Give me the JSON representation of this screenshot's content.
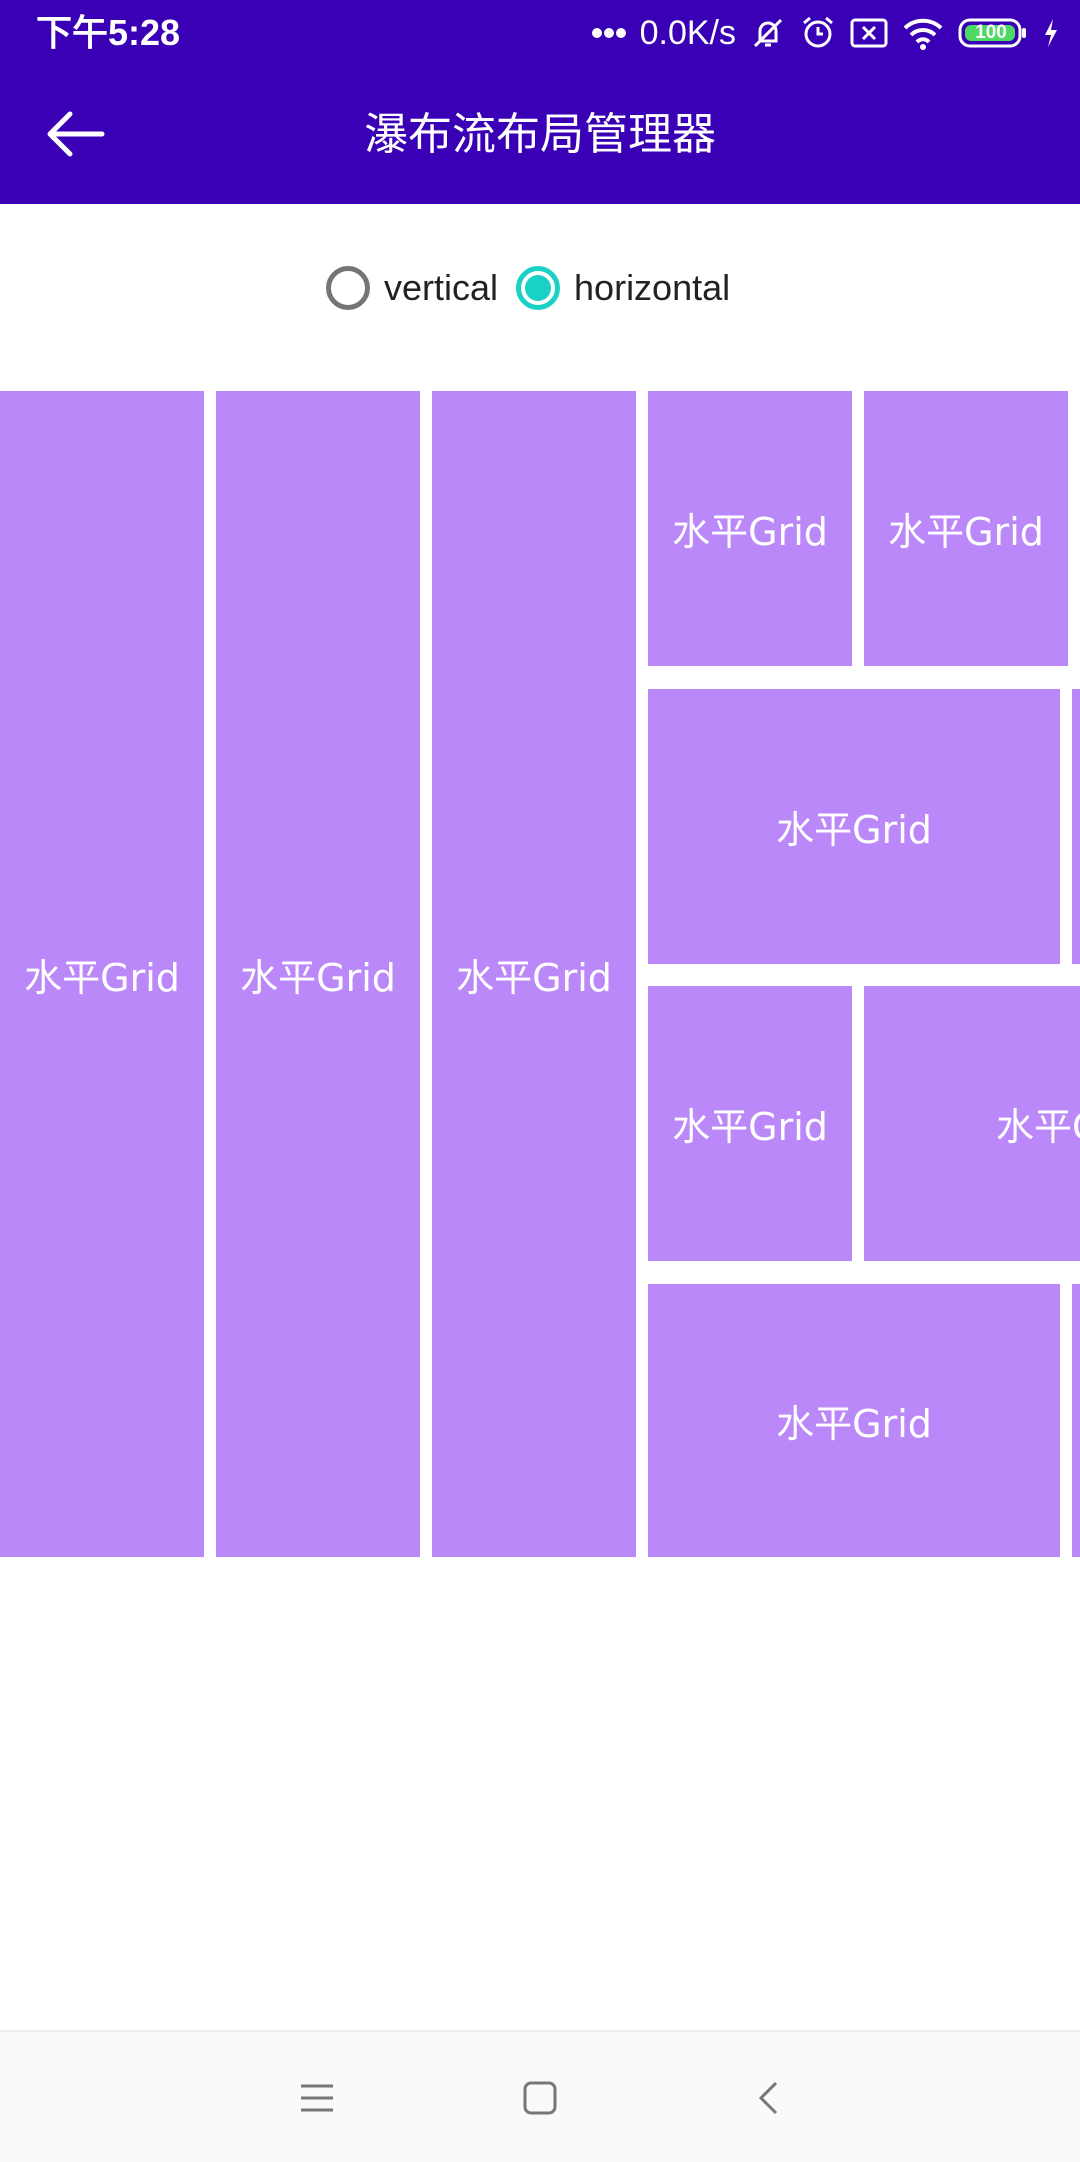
{
  "status_bar": {
    "time": "下午5:28",
    "network_speed": "0.0K/s",
    "battery": "100",
    "icons": [
      "dots-icon",
      "mute-icon",
      "alarm-icon",
      "sim-off-icon",
      "wifi-icon",
      "battery-icon",
      "charging-icon"
    ]
  },
  "app_bar": {
    "title": "瀑布流布局管理器",
    "back_icon": "arrow-back-icon"
  },
  "orientation": {
    "options": [
      "vertical",
      "horizontal"
    ],
    "selected": "horizontal"
  },
  "grid": {
    "tile_color": "#bb88fa",
    "items": [
      {
        "label": "水平Grid"
      },
      {
        "label": "水平Grid"
      },
      {
        "label": "水平Grid"
      },
      {
        "label": "水平Grid"
      },
      {
        "label": "水平Grid"
      },
      {
        "label": "水平Grid"
      },
      {
        "label": "水平Grid"
      },
      {
        "label": "水平Grid"
      },
      {
        "label": "水平Grid"
      },
      {
        "label": ""
      },
      {
        "label": ""
      }
    ]
  },
  "nav_bar": {
    "icons": [
      "menu-icon",
      "home-icon",
      "back-icon"
    ]
  },
  "colors": {
    "primary": "#3a00b6",
    "accent": "#1ad1c6",
    "tile": "#bb88fa"
  }
}
